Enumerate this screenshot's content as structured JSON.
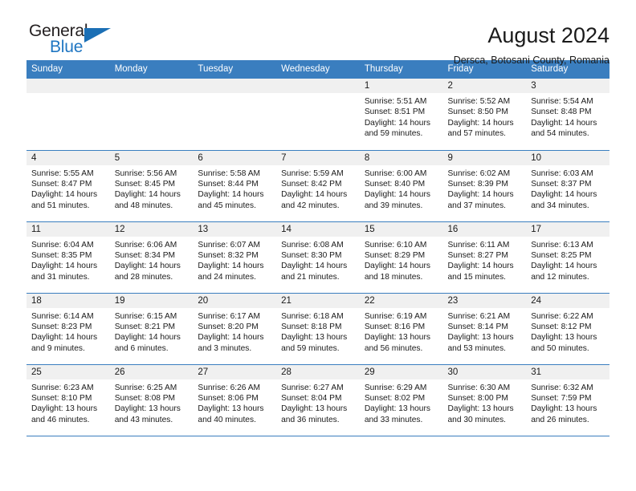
{
  "brand": {
    "name_top": "General",
    "name_bottom": "Blue",
    "accent_color": "#1b6fb5",
    "triangle_icon": "logo-triangle-icon"
  },
  "header": {
    "title": "August 2024",
    "subtitle": "Dersca, Botosani County, Romania"
  },
  "colors": {
    "header_band": "#3a7ebf",
    "daynum_band": "#f0f0f0",
    "row_divider": "#3a7ebf",
    "text": "#1a1a1a",
    "brand_blue": "#1f76c2"
  },
  "weekdays": [
    "Sunday",
    "Monday",
    "Tuesday",
    "Wednesday",
    "Thursday",
    "Friday",
    "Saturday"
  ],
  "labels": {
    "sunrise_prefix": "Sunrise:",
    "sunset_prefix": "Sunset:",
    "daylight_prefix": "Daylight:"
  },
  "weeks": [
    [
      {
        "day": "",
        "line1": "",
        "line2": "",
        "line3": "",
        "line4": ""
      },
      {
        "day": "",
        "line1": "",
        "line2": "",
        "line3": "",
        "line4": ""
      },
      {
        "day": "",
        "line1": "",
        "line2": "",
        "line3": "",
        "line4": ""
      },
      {
        "day": "",
        "line1": "",
        "line2": "",
        "line3": "",
        "line4": ""
      },
      {
        "day": "1",
        "line1": "Sunrise: 5:51 AM",
        "line2": "Sunset: 8:51 PM",
        "line3": "Daylight: 14 hours",
        "line4": "and 59 minutes."
      },
      {
        "day": "2",
        "line1": "Sunrise: 5:52 AM",
        "line2": "Sunset: 8:50 PM",
        "line3": "Daylight: 14 hours",
        "line4": "and 57 minutes."
      },
      {
        "day": "3",
        "line1": "Sunrise: 5:54 AM",
        "line2": "Sunset: 8:48 PM",
        "line3": "Daylight: 14 hours",
        "line4": "and 54 minutes."
      }
    ],
    [
      {
        "day": "4",
        "line1": "Sunrise: 5:55 AM",
        "line2": "Sunset: 8:47 PM",
        "line3": "Daylight: 14 hours",
        "line4": "and 51 minutes."
      },
      {
        "day": "5",
        "line1": "Sunrise: 5:56 AM",
        "line2": "Sunset: 8:45 PM",
        "line3": "Daylight: 14 hours",
        "line4": "and 48 minutes."
      },
      {
        "day": "6",
        "line1": "Sunrise: 5:58 AM",
        "line2": "Sunset: 8:44 PM",
        "line3": "Daylight: 14 hours",
        "line4": "and 45 minutes."
      },
      {
        "day": "7",
        "line1": "Sunrise: 5:59 AM",
        "line2": "Sunset: 8:42 PM",
        "line3": "Daylight: 14 hours",
        "line4": "and 42 minutes."
      },
      {
        "day": "8",
        "line1": "Sunrise: 6:00 AM",
        "line2": "Sunset: 8:40 PM",
        "line3": "Daylight: 14 hours",
        "line4": "and 39 minutes."
      },
      {
        "day": "9",
        "line1": "Sunrise: 6:02 AM",
        "line2": "Sunset: 8:39 PM",
        "line3": "Daylight: 14 hours",
        "line4": "and 37 minutes."
      },
      {
        "day": "10",
        "line1": "Sunrise: 6:03 AM",
        "line2": "Sunset: 8:37 PM",
        "line3": "Daylight: 14 hours",
        "line4": "and 34 minutes."
      }
    ],
    [
      {
        "day": "11",
        "line1": "Sunrise: 6:04 AM",
        "line2": "Sunset: 8:35 PM",
        "line3": "Daylight: 14 hours",
        "line4": "and 31 minutes."
      },
      {
        "day": "12",
        "line1": "Sunrise: 6:06 AM",
        "line2": "Sunset: 8:34 PM",
        "line3": "Daylight: 14 hours",
        "line4": "and 28 minutes."
      },
      {
        "day": "13",
        "line1": "Sunrise: 6:07 AM",
        "line2": "Sunset: 8:32 PM",
        "line3": "Daylight: 14 hours",
        "line4": "and 24 minutes."
      },
      {
        "day": "14",
        "line1": "Sunrise: 6:08 AM",
        "line2": "Sunset: 8:30 PM",
        "line3": "Daylight: 14 hours",
        "line4": "and 21 minutes."
      },
      {
        "day": "15",
        "line1": "Sunrise: 6:10 AM",
        "line2": "Sunset: 8:29 PM",
        "line3": "Daylight: 14 hours",
        "line4": "and 18 minutes."
      },
      {
        "day": "16",
        "line1": "Sunrise: 6:11 AM",
        "line2": "Sunset: 8:27 PM",
        "line3": "Daylight: 14 hours",
        "line4": "and 15 minutes."
      },
      {
        "day": "17",
        "line1": "Sunrise: 6:13 AM",
        "line2": "Sunset: 8:25 PM",
        "line3": "Daylight: 14 hours",
        "line4": "and 12 minutes."
      }
    ],
    [
      {
        "day": "18",
        "line1": "Sunrise: 6:14 AM",
        "line2": "Sunset: 8:23 PM",
        "line3": "Daylight: 14 hours",
        "line4": "and 9 minutes."
      },
      {
        "day": "19",
        "line1": "Sunrise: 6:15 AM",
        "line2": "Sunset: 8:21 PM",
        "line3": "Daylight: 14 hours",
        "line4": "and 6 minutes."
      },
      {
        "day": "20",
        "line1": "Sunrise: 6:17 AM",
        "line2": "Sunset: 8:20 PM",
        "line3": "Daylight: 14 hours",
        "line4": "and 3 minutes."
      },
      {
        "day": "21",
        "line1": "Sunrise: 6:18 AM",
        "line2": "Sunset: 8:18 PM",
        "line3": "Daylight: 13 hours",
        "line4": "and 59 minutes."
      },
      {
        "day": "22",
        "line1": "Sunrise: 6:19 AM",
        "line2": "Sunset: 8:16 PM",
        "line3": "Daylight: 13 hours",
        "line4": "and 56 minutes."
      },
      {
        "day": "23",
        "line1": "Sunrise: 6:21 AM",
        "line2": "Sunset: 8:14 PM",
        "line3": "Daylight: 13 hours",
        "line4": "and 53 minutes."
      },
      {
        "day": "24",
        "line1": "Sunrise: 6:22 AM",
        "line2": "Sunset: 8:12 PM",
        "line3": "Daylight: 13 hours",
        "line4": "and 50 minutes."
      }
    ],
    [
      {
        "day": "25",
        "line1": "Sunrise: 6:23 AM",
        "line2": "Sunset: 8:10 PM",
        "line3": "Daylight: 13 hours",
        "line4": "and 46 minutes."
      },
      {
        "day": "26",
        "line1": "Sunrise: 6:25 AM",
        "line2": "Sunset: 8:08 PM",
        "line3": "Daylight: 13 hours",
        "line4": "and 43 minutes."
      },
      {
        "day": "27",
        "line1": "Sunrise: 6:26 AM",
        "line2": "Sunset: 8:06 PM",
        "line3": "Daylight: 13 hours",
        "line4": "and 40 minutes."
      },
      {
        "day": "28",
        "line1": "Sunrise: 6:27 AM",
        "line2": "Sunset: 8:04 PM",
        "line3": "Daylight: 13 hours",
        "line4": "and 36 minutes."
      },
      {
        "day": "29",
        "line1": "Sunrise: 6:29 AM",
        "line2": "Sunset: 8:02 PM",
        "line3": "Daylight: 13 hours",
        "line4": "and 33 minutes."
      },
      {
        "day": "30",
        "line1": "Sunrise: 6:30 AM",
        "line2": "Sunset: 8:00 PM",
        "line3": "Daylight: 13 hours",
        "line4": "and 30 minutes."
      },
      {
        "day": "31",
        "line1": "Sunrise: 6:32 AM",
        "line2": "Sunset: 7:59 PM",
        "line3": "Daylight: 13 hours",
        "line4": "and 26 minutes."
      }
    ]
  ]
}
